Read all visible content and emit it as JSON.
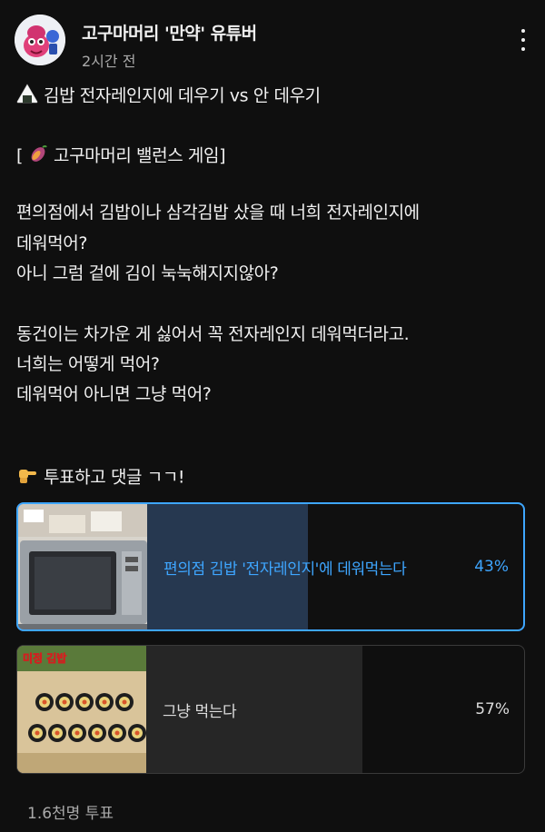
{
  "post": {
    "channel_name": "고구마머리 '만약' 유튜버",
    "time": "2시간 전",
    "title": "김밥 전자레인지에 데우기 vs 안 데우기",
    "tag": "고구마머리 밸런스 게임",
    "tag_open": "[",
    "tag_close": "]",
    "body": [
      "편의점에서 김밥이나 삼각김밥 샀을 때 너희 전자레인지에",
      "데워먹어?",
      "아니  그럼 겉에 김이 눅눅해지지않아?",
      "동건이는 차가운 게 싫어서 꼭 전자레인지 데워먹더라고.",
      "너희는 어떻게 먹어?",
      "데워먹어  아니면 그냥 먹어?"
    ],
    "call_to_action": "투표하고 댓글 ㄱㄱ!"
  },
  "poll": {
    "options": [
      {
        "label": "편의점 김밥 '전자레인지'에 데워먹는다",
        "percent": "43%",
        "value": 0.43,
        "selected": true
      },
      {
        "label": "그냥 먹는다",
        "percent": "57%",
        "value": 0.57,
        "selected": false
      }
    ],
    "votes": "1.6천명 투표",
    "thumb2_caption": "미정 김밥"
  },
  "colors": {
    "background": "#0f0f0f",
    "accent": "#3ea6ff",
    "selected_fill": "#263850",
    "unselected_fill": "#262626"
  },
  "icons": [
    "riceball-icon",
    "sweet-potato-icon",
    "pointing-hand-icon",
    "more-vert-icon"
  ]
}
